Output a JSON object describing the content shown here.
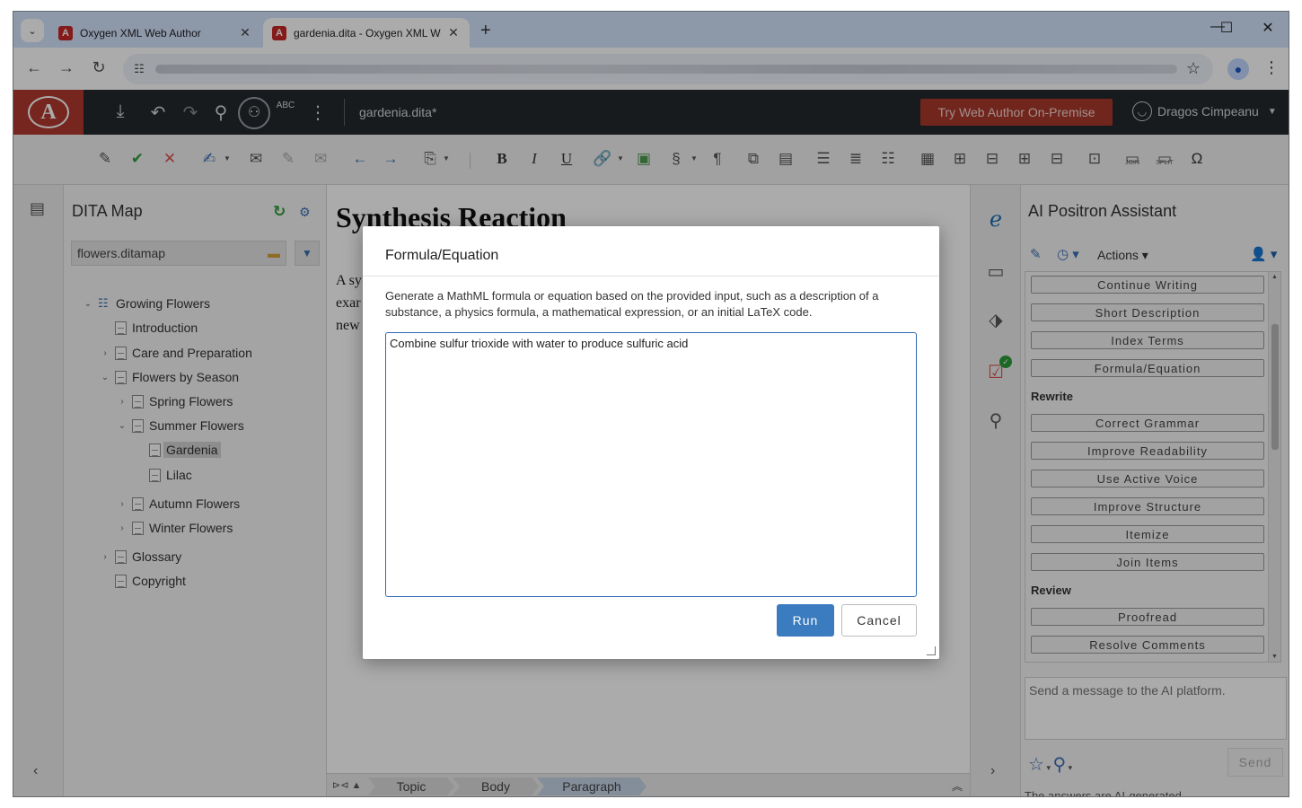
{
  "browser": {
    "tabs": [
      {
        "favicon": "A",
        "label": "Oxygen XML Web Author",
        "close": "✕"
      },
      {
        "favicon": "A",
        "label": "gardenia.dita - Oxygen XML Web Author",
        "close": "✕"
      }
    ],
    "new_tab": "+",
    "window_controls": {
      "minimize": "—",
      "maximize": "☐",
      "close": "✕"
    },
    "nav": {
      "back": "←",
      "forward": "→",
      "reload": "↻"
    },
    "bookmark_star": "☆",
    "menu": "⋮"
  },
  "app": {
    "logo": "A",
    "document_title": "gardenia.dita*",
    "try_button": "Try Web Author On-Premise",
    "user_name": "Dragos Cimpeanu",
    "toolbar_icons": {
      "download": "⤓",
      "undo": "↶",
      "redo": "↷",
      "search": "⚲",
      "collaborate": "⚇",
      "spellcheck": "ABC",
      "more": "⋮"
    }
  },
  "edit_toolbar": {
    "bold": "B",
    "italic": "I",
    "underline": "U",
    "section": "§",
    "pilcrow": "¶",
    "omega": "Ω",
    "join": "JOIN",
    "split": "SPLIT"
  },
  "dita_map": {
    "title": "DITA Map",
    "map_file": "flowers.ditamap",
    "tree": [
      {
        "label": "Growing Flowers",
        "toggle": "⌄"
      },
      {
        "label": "Introduction",
        "toggle": ""
      },
      {
        "label": "Care and Preparation",
        "toggle": "›"
      },
      {
        "label": "Flowers by Season",
        "toggle": "⌄"
      },
      {
        "label": "Spring Flowers",
        "toggle": "›"
      },
      {
        "label": "Summer Flowers",
        "toggle": "⌄"
      },
      {
        "label": "Gardenia",
        "toggle": ""
      },
      {
        "label": "Lilac",
        "toggle": ""
      },
      {
        "label": "Autumn Flowers",
        "toggle": "›"
      },
      {
        "label": "Winter Flowers",
        "toggle": "›"
      },
      {
        "label": "Glossary",
        "toggle": "›"
      },
      {
        "label": "Copyright",
        "toggle": ""
      }
    ]
  },
  "editor": {
    "heading": "Synthesis Reaction",
    "paragraph_lines": [
      "A sy",
      "exar",
      "new"
    ]
  },
  "breadcrumb": {
    "items": [
      "Topic",
      "Body",
      "Paragraph"
    ]
  },
  "ai_assistant": {
    "title": "AI Positron Assistant",
    "actions_label": "Actions",
    "buttons_top": [
      "Continue Writing",
      "Short Description",
      "Index Terms",
      "Formula/Equation"
    ],
    "section_rewrite": "Rewrite",
    "buttons_rewrite": [
      "Correct Grammar",
      "Improve Readability",
      "Use Active Voice",
      "Improve Structure",
      "Itemize",
      "Join Items"
    ],
    "section_review": "Review",
    "buttons_review": [
      "Proofread",
      "Resolve Comments"
    ],
    "input_placeholder": "Send a message to the AI platform.",
    "send_label": "Send",
    "disclaimer": "The answers are AI-generated."
  },
  "dialog": {
    "title": "Formula/Equation",
    "description": "Generate a MathML formula or equation based on the provided input, such as a description of a substance, a physics formula, a mathematical expression, or an initial LaTeX code.",
    "input_value": "Combine sulfur trioxide with water to produce sulfuric acid",
    "run_label": "Run",
    "cancel_label": "Cancel"
  }
}
